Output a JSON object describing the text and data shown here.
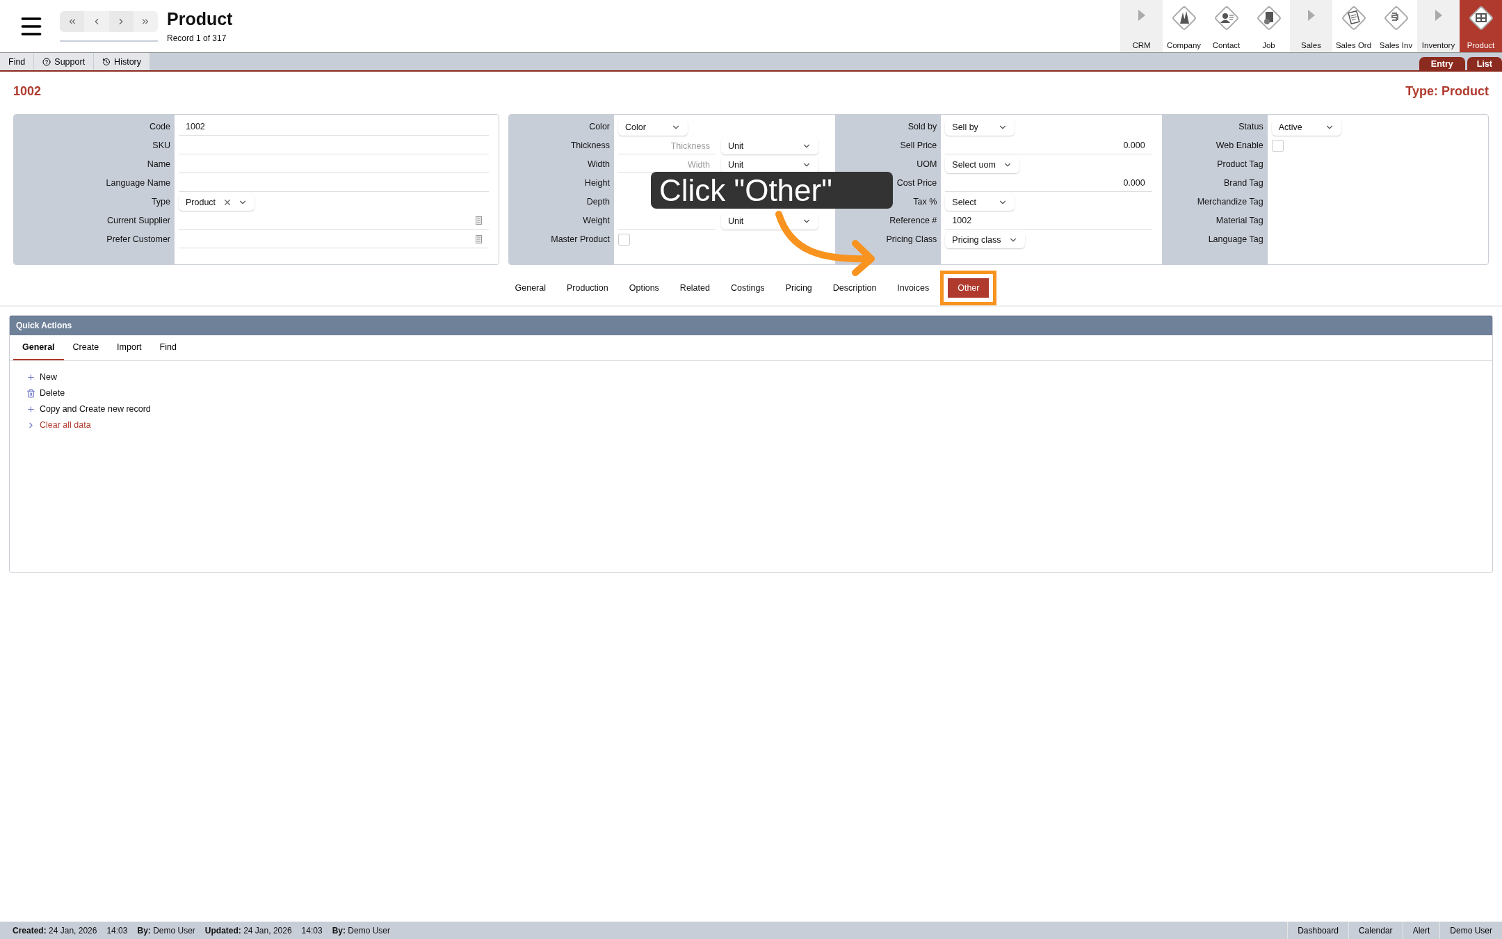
{
  "header": {
    "title": "Product",
    "record": "Record 1 of 317"
  },
  "modules": [
    {
      "label": "CRM",
      "kind": "group",
      "selected": false
    },
    {
      "label": "Company",
      "kind": "company",
      "selected": false
    },
    {
      "label": "Contact",
      "kind": "contact",
      "selected": false
    },
    {
      "label": "Job",
      "kind": "job",
      "selected": false
    },
    {
      "label": "Sales",
      "kind": "group",
      "selected": false
    },
    {
      "label": "Sales Ord",
      "kind": "order",
      "selected": false
    },
    {
      "label": "Sales Inv",
      "kind": "invoice",
      "selected": false
    },
    {
      "label": "Inventory",
      "kind": "group",
      "selected": false
    },
    {
      "label": "Product",
      "kind": "product",
      "selected": true
    }
  ],
  "toolbar": [
    {
      "label": "Find",
      "kind": "plain"
    },
    {
      "label": "Support",
      "kind": "help"
    },
    {
      "label": "History",
      "kind": "history"
    }
  ],
  "view_tabs": [
    {
      "label": "Entry"
    },
    {
      "label": "List"
    }
  ],
  "record_code": "1002",
  "type_label": "Type: Product",
  "panels": [
    {
      "fields": [
        {
          "label": "Code",
          "kind": "text",
          "value": "1002"
        },
        {
          "label": "SKU",
          "kind": "text"
        },
        {
          "label": "Name",
          "kind": "text"
        },
        {
          "label": "Language Name",
          "kind": "text"
        },
        {
          "label": "Type",
          "kind": "select",
          "value": "Product",
          "clearable": true
        },
        {
          "label": "Current Supplier",
          "kind": "lookup"
        },
        {
          "label": "Prefer Customer",
          "kind": "lookup"
        }
      ]
    },
    {
      "fields": [
        {
          "label": "Color",
          "kind": "select",
          "value": "Color"
        },
        {
          "label": "Thickness",
          "kind": "measure",
          "placeholder": "Thickness",
          "unit": "Unit"
        },
        {
          "label": "Width",
          "kind": "measure",
          "placeholder": "Width",
          "unit": "Unit"
        },
        {
          "label": "Height",
          "kind": "covered"
        },
        {
          "label": "Depth",
          "kind": "covered"
        },
        {
          "label": "Weight",
          "kind": "measure",
          "unit": "Unit"
        },
        {
          "label": "Master Product",
          "kind": "checkbox",
          "checked": false
        }
      ]
    },
    {
      "fields": [
        {
          "label": "Sold by",
          "kind": "select",
          "value": "Sell by"
        },
        {
          "label": "Sell Price",
          "kind": "number",
          "value": "0.000"
        },
        {
          "label": "UOM",
          "kind": "select",
          "value": "Select uom"
        },
        {
          "label": "Cost Price",
          "kind": "number",
          "value": "0.000"
        },
        {
          "label": "Tax %",
          "kind": "select",
          "value": "Select"
        },
        {
          "label": "Reference #",
          "kind": "text",
          "value": "1002"
        },
        {
          "label": "Pricing Class",
          "kind": "select",
          "value": "Pricing class"
        }
      ]
    },
    {
      "fields": [
        {
          "label": "Status",
          "kind": "select",
          "value": "Active"
        },
        {
          "label": "Web Enable",
          "kind": "checkbox",
          "checked": false
        },
        {
          "label": "Product Tag",
          "kind": "tag"
        },
        {
          "label": "Brand Tag",
          "kind": "tag"
        },
        {
          "label": "Merchandize Tag",
          "kind": "tag"
        },
        {
          "label": "Material Tag",
          "kind": "tag"
        },
        {
          "label": "Language Tag",
          "kind": "tag"
        }
      ]
    }
  ],
  "section_tabs": [
    {
      "label": "General",
      "selected": false,
      "highlighted": false
    },
    {
      "label": "Production",
      "selected": false,
      "highlighted": false
    },
    {
      "label": "Options",
      "selected": false,
      "highlighted": false
    },
    {
      "label": "Related",
      "selected": false,
      "highlighted": false
    },
    {
      "label": "Costings",
      "selected": false,
      "highlighted": false
    },
    {
      "label": "Pricing",
      "selected": false,
      "highlighted": false
    },
    {
      "label": "Description",
      "selected": false,
      "highlighted": false
    },
    {
      "label": "Invoices",
      "selected": false,
      "highlighted": false
    },
    {
      "label": "Other",
      "selected": true,
      "highlighted": true
    }
  ],
  "quick_actions": {
    "title": "Quick Actions",
    "tabs": [
      {
        "label": "General",
        "selected": true
      },
      {
        "label": "Create",
        "selected": false
      },
      {
        "label": "Import",
        "selected": false
      },
      {
        "label": "Find",
        "selected": false
      }
    ],
    "actions": [
      {
        "label": "New",
        "kind": "add"
      },
      {
        "label": "Delete",
        "kind": "delete"
      },
      {
        "label": "Copy and Create new record",
        "kind": "add"
      },
      {
        "label": "Clear all data",
        "kind": "expand"
      }
    ]
  },
  "callout": {
    "text": "Click \"Other\""
  },
  "footer": {
    "items": [
      {
        "label": "Created:",
        "value": "24 Jan, 2026"
      },
      {
        "value": "14:03"
      },
      {
        "label": "By:",
        "value": "Demo User"
      },
      {
        "label": "Updated:",
        "value": "24 Jan, 2026"
      },
      {
        "value": "14:03"
      },
      {
        "label": "By:",
        "value": "Demo User"
      }
    ],
    "links": [
      "Dashboard",
      "Calendar",
      "Alert",
      "Demo User"
    ]
  }
}
